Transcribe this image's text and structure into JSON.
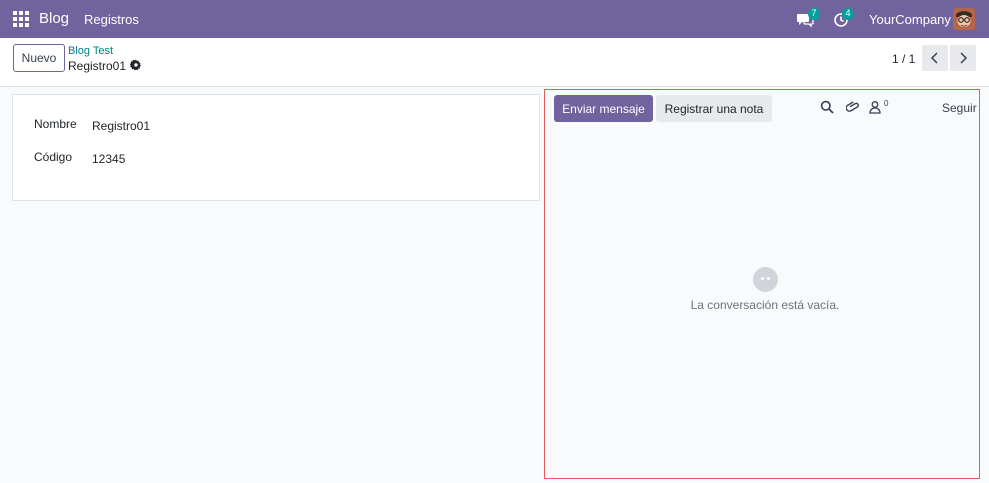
{
  "navbar": {
    "app_name": "Blog",
    "menu_item": "Registros",
    "chat_badge": "7",
    "activity_badge": "4",
    "company": "YourCompany",
    "bg_color": "#71639e"
  },
  "control_panel": {
    "new_button": "Nuevo",
    "breadcrumb": "Blog Test",
    "record_name": "Registro01",
    "pager": "1 / 1"
  },
  "form": {
    "fields": [
      {
        "label": "Nombre",
        "value": "Registro01"
      },
      {
        "label": "Código",
        "value": "12345"
      }
    ]
  },
  "chatter": {
    "send_message": "Enviar mensaje",
    "log_note": "Registrar una nota",
    "follower_count": "0",
    "follow": "Seguir",
    "empty_text": "La conversación está vacía."
  }
}
